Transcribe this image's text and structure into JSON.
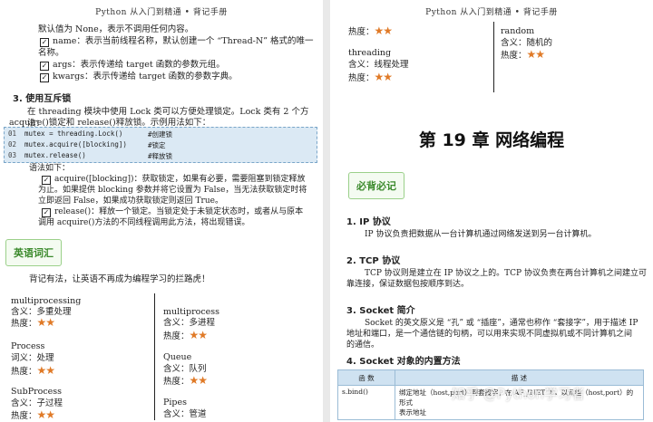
{
  "left": {
    "header": "Python 从入门到精通 • 背记手册",
    "lines": [
      "默认值为 None，表示不调用任何内容。",
      "name：表示当前线程名称，默认创建一个 “Thread-N” 格式的唯一",
      "名称。",
      "args：表示传递给 target 函数的参数元组。",
      "kwargs：表示传递给 target 函数的参数字典。"
    ],
    "section3_title": "3. 使用互斥锁",
    "section3_p1": "在 threading 模块中使用 Lock 类可以方便处理锁定。Lock 类有 2 个方法：",
    "section3_p2": "acquire()锁定和 release()释放锁。示例用法如下：",
    "code": [
      {
        "num": "01",
        "code": "mutex = threading.Lock()",
        "comment": "#创建锁"
      },
      {
        "num": "02",
        "code": "mutex.acquire([blocking])",
        "comment": "#锁定"
      },
      {
        "num": "03",
        "code": "mutex.release()",
        "comment": "#释放锁"
      }
    ],
    "syntax_label": "语法如下：",
    "syntax_lines": [
      "acquire([blocking])：获取锁定，如果有必要，需要阻塞到锁定释放",
      "为止。如果提供 blocking 参数并将它设置为 False，当无法获取锁定时将",
      "立即返回 False，如果成功获取锁定则返回 True。",
      "release()：释放一个锁定。当锁定处于未锁定状态时，或者从与原本",
      "调用 acquire()方法的不同线程调用此方法，将出现错误。"
    ],
    "vocab_badge": "英语词汇",
    "vocab_intro": "背记有法，让英语不再成为编程学习的拦路虎！",
    "vocab_col1": [
      {
        "word": "multiprocessing",
        "meaning": "含义：多重处理",
        "hot": "热度："
      },
      {
        "word": "Process",
        "meaning": "词义：处理",
        "hot": "热度："
      },
      {
        "word": "SubProcess",
        "meaning": "含义：子过程",
        "hot": "热度："
      }
    ],
    "vocab_col2": [
      {
        "word": "multiprocess",
        "meaning": "含义：多进程",
        "hot": "热度："
      },
      {
        "word": "Queue",
        "meaning": "含义：队列",
        "hot": "热度："
      },
      {
        "word": "Pipes",
        "meaning": "含义：管道",
        "hot": "热度："
      }
    ]
  },
  "right": {
    "header": "Python 从入门到精通 • 背记手册",
    "top_col1": [
      {
        "word": "",
        "meaning": "",
        "hot": "热度："
      },
      {
        "word": "threading",
        "meaning": "含义：线程处理",
        "hot": "热度："
      }
    ],
    "top_col2": [
      {
        "word": "random",
        "meaning": "含义：随机的",
        "hot": "热度："
      }
    ],
    "chapter_title": "第 19 章  网络编程",
    "badge": "必背必记",
    "s1_title": "1. IP 协议",
    "s1_text": "IP 协议负责把数据从一台计算机通过网络发送到另一台计算机。",
    "s2_title": "2. TCP 协议",
    "s2_lines": [
      "TCP 协议则是建立在 IP 协议之上的。TCP 协议负责在两台计算机之间建立可",
      "靠连接，保证数据包按顺序到达。"
    ],
    "s3_title": "3. Socket 简介",
    "s3_lines": [
      "Socket 的英文原义是 “孔” 或 “插座”，通常也称作 “套接字”，用于描述 IP",
      "地址和端口，是一个通信链的句柄，可以用来实现不同虚拟机或不同计算机之间",
      "的通信。"
    ],
    "s4_title": "4. Socket 对象的内置方法",
    "table_headers": [
      "函 数",
      "描 述"
    ],
    "table_rows": [
      {
        "func": "s.bind()",
        "desc1": "绑定地址（host,port）到套接字，在 AF_INET 下，以元组（host,port）的形式",
        "desc2": "表示地址"
      }
    ],
    "watermark": "知乎 @Python学习者"
  },
  "stars": "★★",
  "colors": {
    "star": "#e07a27",
    "badge_green": "#3b8a2c",
    "code_bg": "#dbe9f4",
    "table_head": "#cfe2f1"
  }
}
